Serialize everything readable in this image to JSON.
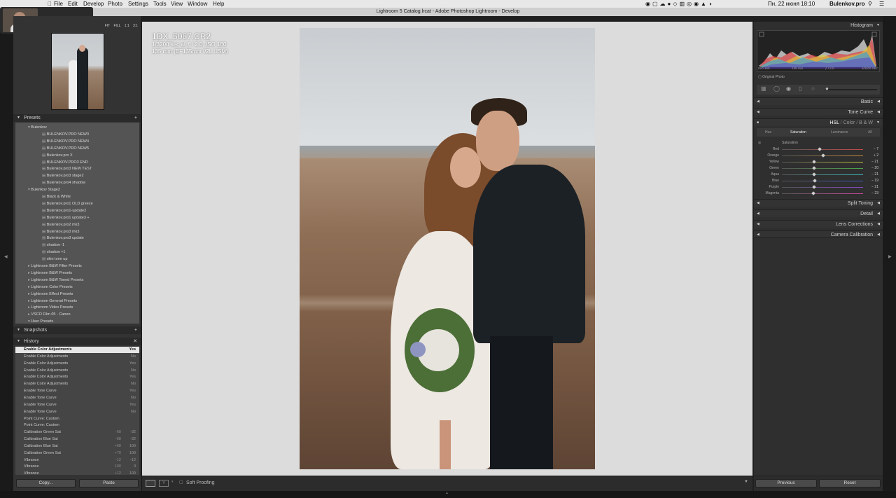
{
  "menubar": {
    "items": [
      "File",
      "Edit",
      "Develop",
      "Photo",
      "Settings",
      "Tools",
      "View",
      "Window",
      "Help"
    ],
    "datetime": "Пн, 22 июня  18:10",
    "user": "Bulenkov.pro"
  },
  "window": {
    "title": "Lightroom 5 Catalog.lrcat - Adobe Photoshop Lightroom - Develop"
  },
  "navigator": {
    "zoom_options": [
      "FIT",
      "FILL",
      "1:1",
      "3:1"
    ]
  },
  "presets": {
    "header": "Presets",
    "items": [
      {
        "label": "Bulenkov",
        "level": 1,
        "type": "folder-open"
      },
      {
        "label": "BULENKOV.PRO NEW3",
        "level": 2,
        "type": "preset"
      },
      {
        "label": "BULENKOV.PRO NEW4",
        "level": 2,
        "type": "preset"
      },
      {
        "label": "BULENKOV.PRO NEW5",
        "level": 2,
        "type": "preset"
      },
      {
        "label": "Bulenkov.pro X",
        "level": 2,
        "type": "preset"
      },
      {
        "label": "BULENKOV.PRO3 END",
        "level": 2,
        "type": "preset"
      },
      {
        "label": "Bulenkov.pro3 NEW TEST",
        "level": 2,
        "type": "preset"
      },
      {
        "label": "Bulenkov.pro3 stage2",
        "level": 2,
        "type": "preset"
      },
      {
        "label": "Bulenkov.pro4 shadow",
        "level": 2,
        "type": "preset"
      },
      {
        "label": "Bulenkov Stage2",
        "level": 1,
        "type": "folder-open"
      },
      {
        "label": "Black & White",
        "level": 2,
        "type": "preset"
      },
      {
        "label": "Bulenkov.pro1 OLD greece",
        "level": 2,
        "type": "preset"
      },
      {
        "label": "Bulenkov.pro1-update2",
        "level": 2,
        "type": "preset"
      },
      {
        "label": "Bulenkov.pro1 update3 +",
        "level": 2,
        "type": "preset"
      },
      {
        "label": "Bulenkov.pro2 mk3",
        "level": 2,
        "type": "preset"
      },
      {
        "label": "Bulenkov.pro3 mk3",
        "level": 2,
        "type": "preset"
      },
      {
        "label": "Bulenkov.pro3 update",
        "level": 2,
        "type": "preset"
      },
      {
        "label": "shadow -1",
        "level": 2,
        "type": "preset"
      },
      {
        "label": "shadow +1",
        "level": 2,
        "type": "preset"
      },
      {
        "label": "skin tone up",
        "level": 2,
        "type": "preset"
      },
      {
        "label": "Lightroom B&W Filter Presets",
        "level": 1,
        "type": "folder"
      },
      {
        "label": "Lightroom B&W Presets",
        "level": 1,
        "type": "folder"
      },
      {
        "label": "Lightroom B&W Toned Presets",
        "level": 1,
        "type": "folder"
      },
      {
        "label": "Lightroom Color Presets",
        "level": 1,
        "type": "folder"
      },
      {
        "label": "Lightroom Effect Presets",
        "level": 1,
        "type": "folder"
      },
      {
        "label": "Lightroom General Presets",
        "level": 1,
        "type": "folder"
      },
      {
        "label": "Lightroom Video Presets",
        "level": 1,
        "type": "folder"
      },
      {
        "label": "VSCO Film 05 - Canon",
        "level": 1,
        "type": "folder"
      },
      {
        "label": "User Presets",
        "level": 1,
        "type": "folder-open"
      }
    ]
  },
  "snapshots": {
    "header": "Snapshots"
  },
  "history": {
    "header": "History",
    "items": [
      {
        "label": "Enable Color Adjustments",
        "from": "",
        "to": "Yes",
        "selected": true
      },
      {
        "label": "Enable Color Adjustments",
        "from": "",
        "to": "No"
      },
      {
        "label": "Enable Color Adjustments",
        "from": "",
        "to": "Yes"
      },
      {
        "label": "Enable Color Adjustments",
        "from": "",
        "to": "No"
      },
      {
        "label": "Enable Color Adjustments",
        "from": "",
        "to": "Yes"
      },
      {
        "label": "Enable Color Adjustments",
        "from": "",
        "to": "No"
      },
      {
        "label": "Enable Tone Curve",
        "from": "",
        "to": "Yes"
      },
      {
        "label": "Enable Tone Curve",
        "from": "",
        "to": "No"
      },
      {
        "label": "Enable Tone Curve",
        "from": "",
        "to": "Yes"
      },
      {
        "label": "Enable Tone Curve",
        "from": "",
        "to": "No"
      },
      {
        "label": "Point Curve: Custom",
        "from": "",
        "to": ""
      },
      {
        "label": "Point Curve: Custom",
        "from": "",
        "to": ""
      },
      {
        "label": "Calibration Green Sat",
        "from": "-68",
        "to": "-32"
      },
      {
        "label": "Calibration Blue Sat",
        "from": "-68",
        "to": "-32"
      },
      {
        "label": "Calibration Blue Sat",
        "from": "+68",
        "to": "100"
      },
      {
        "label": "Calibration Green Sat",
        "from": "+70",
        "to": "100"
      },
      {
        "label": "Vibrance",
        "from": "-12",
        "to": "-12"
      },
      {
        "label": "Vibrance",
        "from": "100",
        "to": "0"
      },
      {
        "label": "Vibrance",
        "from": "+12",
        "to": "100"
      }
    ]
  },
  "left_buttons": {
    "copy": "Copy...",
    "paste": "Paste"
  },
  "photo_info": {
    "filename": "1DX_5067.CR2",
    "exposure": "1/3200 sec at ƒ / 2,0, ISO 160",
    "lens": "135 mm (EF135mm f/2L USM)"
  },
  "toolbar": {
    "soft_proofing": "Soft Proofing"
  },
  "histogram": {
    "header": "Histogram",
    "iso": "ISO 160",
    "focal": "135 mm",
    "aperture": "ƒ / 2,0",
    "shutter": "1/3200 SEC",
    "original_photo": "Original Photo"
  },
  "panels": {
    "basic": "Basic",
    "tone_curve": "Tone Curve",
    "hsl_tabs": [
      "HSL",
      "/",
      "Color",
      "/",
      "B & W"
    ],
    "split_toning": "Split Toning",
    "detail": "Detail",
    "lens_corrections": "Lens Corrections",
    "camera_calibration": "Camera Calibration"
  },
  "hsl": {
    "subtabs": [
      "Hue",
      "Saturation",
      "Luminance",
      "All"
    ],
    "active_subtab": "Saturation",
    "group_label": "Saturation",
    "sliders": [
      {
        "name": "Red",
        "value": -7,
        "display": "− 7"
      },
      {
        "name": "Orange",
        "value": 2,
        "display": "+ 2"
      },
      {
        "name": "Yellow",
        "value": -21,
        "display": "− 21"
      },
      {
        "name": "Green",
        "value": -20,
        "display": "− 20"
      },
      {
        "name": "Aqua",
        "value": -21,
        "display": "− 21"
      },
      {
        "name": "Blue",
        "value": -19,
        "display": "− 19"
      },
      {
        "name": "Purple",
        "value": -21,
        "display": "− 21"
      },
      {
        "name": "Magenta",
        "value": -23,
        "display": "− 23"
      }
    ]
  },
  "right_buttons": {
    "previous": "Previous",
    "reset": "Reset"
  },
  "colors": {
    "selected_row": "#e6e6e6",
    "panel_bg": "#333333",
    "center_bg": "#dcdcdc"
  }
}
